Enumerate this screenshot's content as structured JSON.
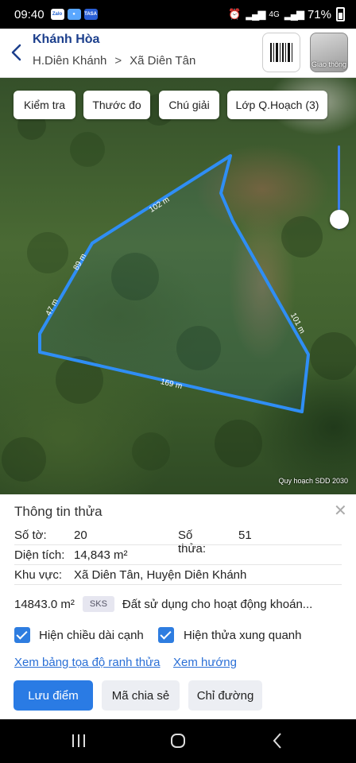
{
  "status_bar": {
    "time": "09:40",
    "apps": [
      {
        "icon": "zalo-icon",
        "label": "Zalo",
        "color": "#ffffff"
      },
      {
        "icon": "messenger-icon",
        "label": "",
        "color": "#5aa7ff"
      },
      {
        "icon": "tasa-icon",
        "label": "TASA",
        "color": "#2a5fd6"
      }
    ],
    "network": "4G",
    "battery": "71%"
  },
  "header": {
    "province": "Khánh Hòa",
    "district": "H.Diên Khánh",
    "commune": "Xã Diên Tân",
    "traffic_label": "Giao thông"
  },
  "map": {
    "chips": [
      "Kiểm tra",
      "Thước đo",
      "Chú giải",
      "Lớp Q.Hoạch (3)"
    ],
    "edge_labels": [
      "102 m",
      "169 m",
      "47 m",
      "89 m",
      "101 m"
    ],
    "credit": "Quy hoạch SDD 2030",
    "boundary_color": "#2f8ef5",
    "zoom_level": 0.75
  },
  "panel": {
    "title": "Thông tin thửa",
    "so_to_label": "Số tờ:",
    "so_to_value": "20",
    "so_thua_label": "Số thửa:",
    "so_thua_value": "51",
    "dien_tich_label": "Diện tích:",
    "dien_tich_value": "14,843 m²",
    "khu_vuc_label": "Khu vực:",
    "khu_vuc_value": "Xã Diên Tân, Huyện Diên Khánh",
    "area_exact": "14843.0 m²",
    "land_code": "SKS",
    "land_use": "Đất sử dụng cho hoạt động khoán...",
    "check_edges_label": "Hiện chiều dài cạnh",
    "check_neighbors_label": "Hiện thửa xung quanh",
    "link_coords": "Xem bảng tọa độ ranh thửa",
    "link_direction": "Xem hướng",
    "btn_save": "Lưu điểm",
    "btn_share": "Mã chia sẻ",
    "btn_route": "Chỉ đường"
  }
}
